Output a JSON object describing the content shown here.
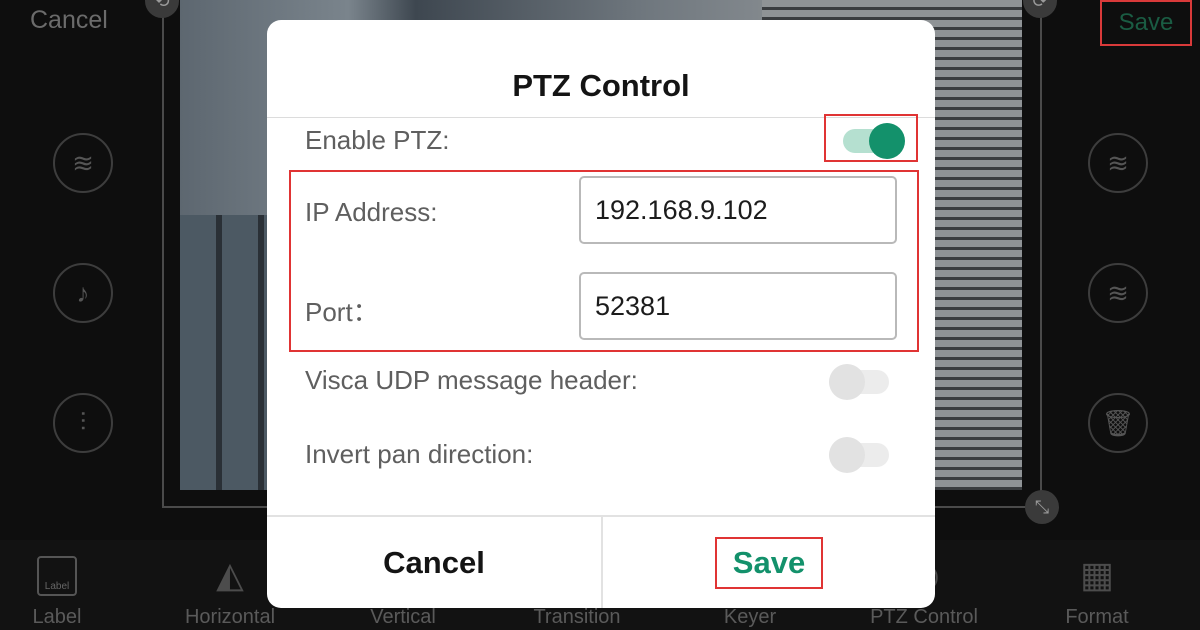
{
  "editor": {
    "cancel_label": "Cancel",
    "save_label": "Save"
  },
  "toolbar": [
    {
      "label": "Label",
      "icon": "label-icon"
    },
    {
      "label": "Horizontal",
      "icon": "flip-horizontal-icon"
    },
    {
      "label": "Vertical",
      "icon": "flip-vertical-icon"
    },
    {
      "label": "Transition",
      "icon": "transition-icon"
    },
    {
      "label": "Keyer",
      "icon": "keyer-icon"
    },
    {
      "label": "PTZ Control",
      "icon": "ptz-icon"
    },
    {
      "label": "Format",
      "icon": "format-brush-icon"
    }
  ],
  "label_icon_text": "Label",
  "dialog": {
    "title": "PTZ Control",
    "enable_ptz_label": "Enable PTZ:",
    "enable_ptz": true,
    "ip_label": "IP Address:",
    "ip_value": "192.168.9.102",
    "port_label": "Port：",
    "port_value": "52381",
    "visca_label": "Visca UDP message header:",
    "visca_enabled": false,
    "invert_pan_label": "Invert pan direction:",
    "invert_pan_enabled": false,
    "cancel_label": "Cancel",
    "save_label": "Save"
  },
  "colors": {
    "accent": "#13916b",
    "highlight_box": "#e03434"
  }
}
